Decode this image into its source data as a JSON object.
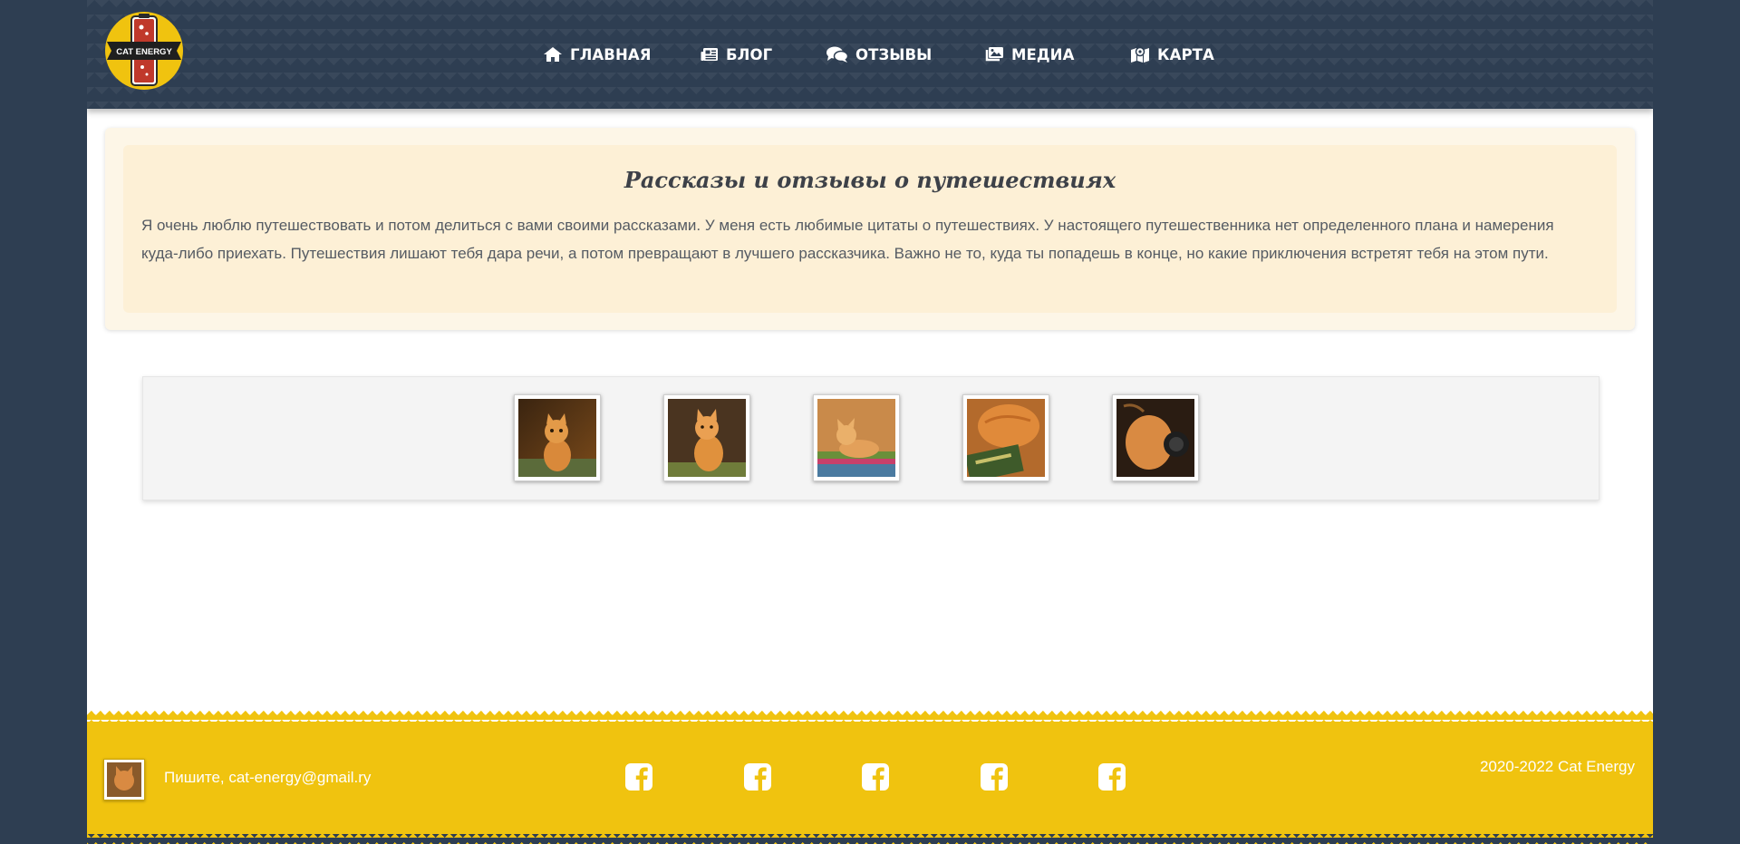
{
  "colors": {
    "page_bg": "#2e3e52",
    "header_bg": "#2e3e52",
    "accent_yellow": "#f0c30f",
    "card_bg": "#fdf0d6",
    "text": "#555b63"
  },
  "header": {
    "logo_text": "CAT ENERGY",
    "nav": [
      {
        "label": "ГЛАВНАЯ",
        "icon": "home-icon"
      },
      {
        "label": "БЛОГ",
        "icon": "newspaper-icon"
      },
      {
        "label": "ОТЗЫВЫ",
        "icon": "comments-icon"
      },
      {
        "label": "МЕДИА",
        "icon": "images-icon"
      },
      {
        "label": "КАРТА",
        "icon": "map-icon"
      }
    ]
  },
  "intro": {
    "title": "Рассказы и отзывы о путешествиях",
    "text": "Я очень люблю путешествовать и потом делиться с вами своими рассказами. У меня есть любимые цитаты о путешествиях. У настоящего путешественника нет определенного плана и намерения куда-либо приехать. Путешествия лишают тебя дара речи, а потом превращают в лучшего рассказчика. Важно не то, куда ты попадешь в конце, но какие приключения встретят тебя на этом пути."
  },
  "gallery": {
    "photos": [
      {
        "icon": "kitten-photo"
      },
      {
        "icon": "kitten-photo"
      },
      {
        "icon": "kitten-photo"
      },
      {
        "icon": "kitten-photo"
      },
      {
        "icon": "kitten-photo"
      }
    ]
  },
  "footer": {
    "contact": "Пишите, cat-energy@gmail.ry",
    "social": [
      {
        "icon": "facebook-icon"
      },
      {
        "icon": "facebook-icon"
      },
      {
        "icon": "facebook-icon"
      },
      {
        "icon": "facebook-icon"
      },
      {
        "icon": "facebook-icon"
      }
    ],
    "copyright": "2020-2022 Cat Energy"
  }
}
